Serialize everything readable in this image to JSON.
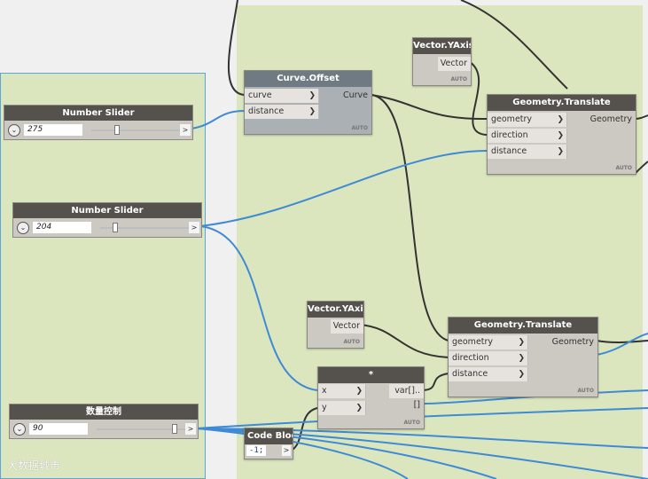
{
  "colors": {
    "canvas": "#f0f0f0",
    "group": "#dbe6bf",
    "group_border": "#5aa6d8",
    "wire_data": "#333333",
    "wire_selected": "#3e8ad4",
    "header": "#55524e"
  },
  "nodes": {
    "number_slider_1": {
      "title": "Number Slider",
      "value": "275",
      "fraction": 0.31,
      "out": ">"
    },
    "number_slider_2": {
      "title": "Number Slider",
      "value": "204",
      "fraction": 0.28,
      "out": ">"
    },
    "number_slider_3": {
      "title": "数量控制",
      "value": "90",
      "fraction": 0.87,
      "out": ">"
    },
    "curve_offset": {
      "title": "Curve.Offset",
      "inputs": [
        "curve",
        "distance"
      ],
      "output": "Curve",
      "lacing": "AUTO"
    },
    "vector_yaxis_1": {
      "title": "Vector.YAxis",
      "output": "Vector",
      "lacing": "AUTO"
    },
    "vector_yaxis_2": {
      "title": "Vector.YAxis",
      "output": "Vector",
      "lacing": "AUTO"
    },
    "geometry_translate_1": {
      "title": "Geometry.Translate",
      "inputs": [
        "geometry",
        "direction",
        "distance"
      ],
      "output": "Geometry",
      "lacing": "AUTO"
    },
    "geometry_translate_2": {
      "title": "Geometry.Translate",
      "inputs": [
        "geometry",
        "direction",
        "distance"
      ],
      "output": "Geometry",
      "lacing": "AUTO"
    },
    "multiply": {
      "title": "*",
      "inputs": [
        "x",
        "y"
      ],
      "output": "var[]..[]",
      "lacing": "AUTO"
    },
    "code_block": {
      "title": "Code Block",
      "code": "-1;",
      "out": ">"
    }
  },
  "watermark": "大数据城市"
}
